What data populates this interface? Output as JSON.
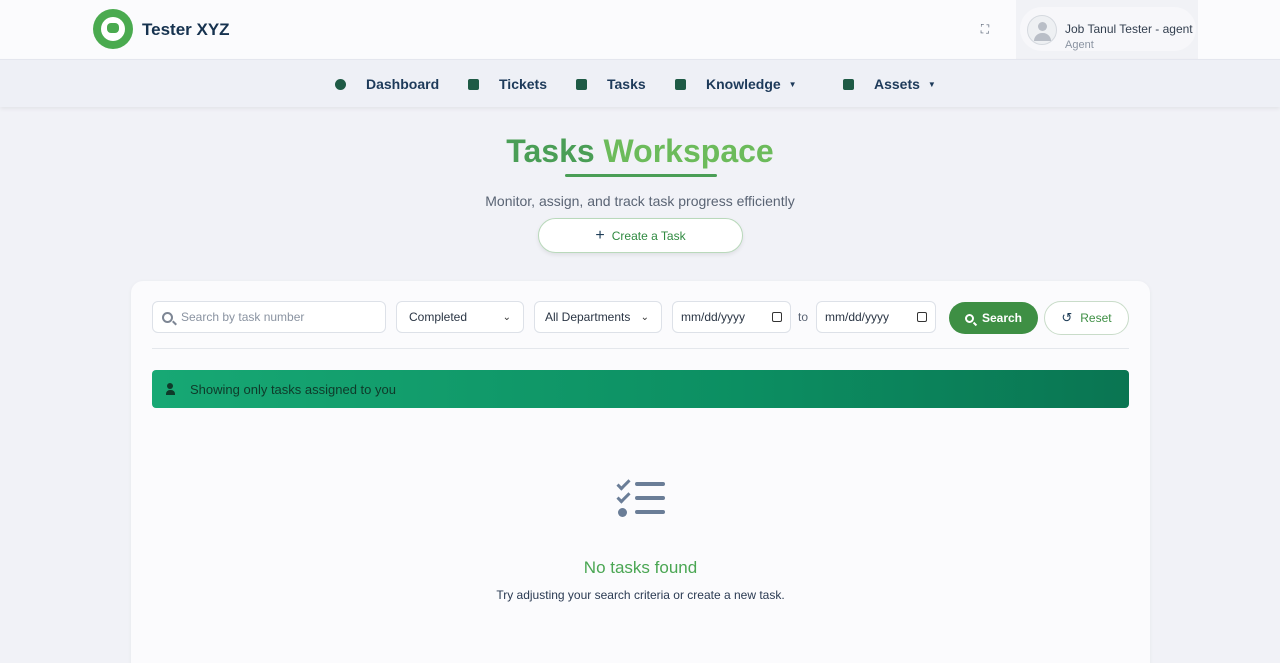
{
  "brand": {
    "name": "Tester XYZ",
    "accent": "#4aaa4f"
  },
  "user": {
    "name": "Job Tanul Tester - agent",
    "role": "Agent"
  },
  "nav": [
    {
      "label": "Dashboard",
      "icon": "dashboard-icon"
    },
    {
      "label": "Tickets",
      "icon": "ticket-icon"
    },
    {
      "label": "Tasks",
      "icon": "tasks-icon"
    },
    {
      "label": "Knowledge",
      "icon": "book-icon",
      "dropdown": true
    },
    {
      "label": "Assets",
      "icon": "briefcase-icon",
      "dropdown": true
    }
  ],
  "page": {
    "title_part1": "Tasks",
    "title_part2": "Workspace",
    "subtitle": "Monitor, assign, and track task progress efficiently",
    "create_label": "Create a Task"
  },
  "filters": {
    "search_placeholder": "Search by task number",
    "status_value": "Completed",
    "department_value": "All Departments",
    "date_from": "mm/dd/yyyy",
    "date_to": "mm/dd/yyyy",
    "to_label": "to",
    "search_label": "Search",
    "reset_label": "Reset"
  },
  "banner": {
    "text": "Showing only tasks assigned to you"
  },
  "empty": {
    "title": "No tasks found",
    "subtitle": "Try adjusting your search criteria or create a new task."
  }
}
